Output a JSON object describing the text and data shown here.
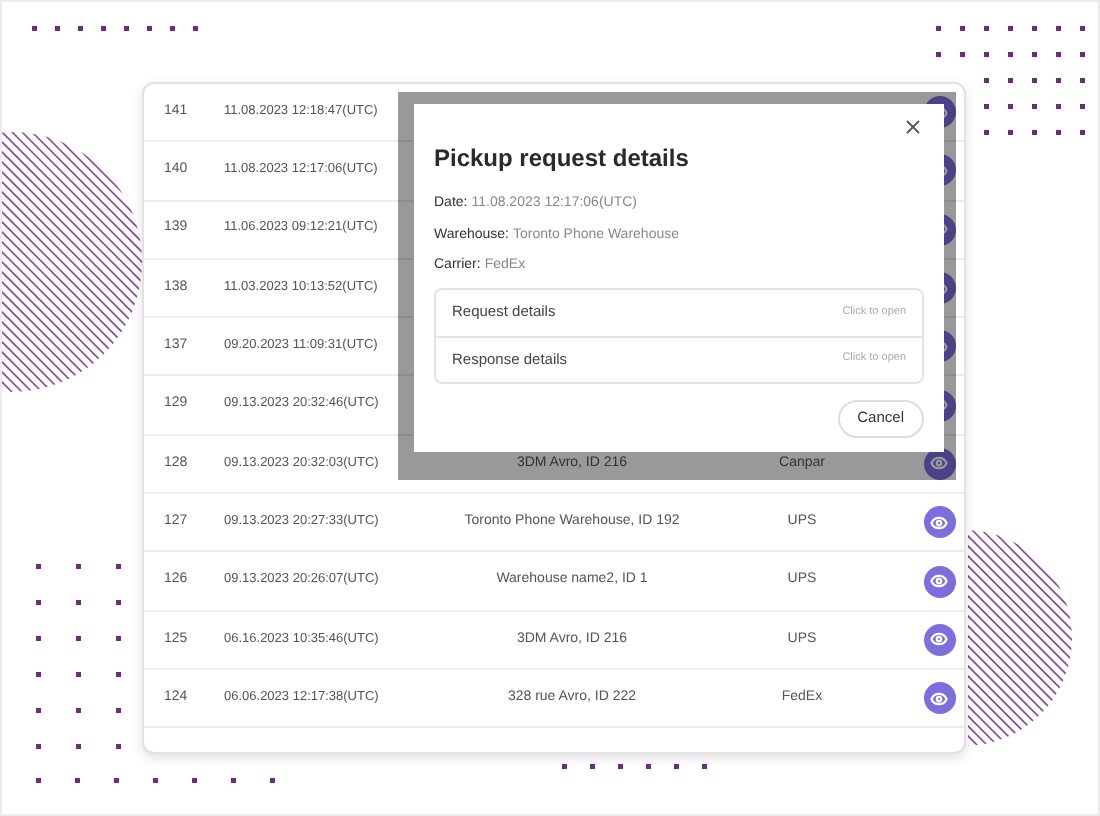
{
  "table": {
    "rows": [
      {
        "id": "141",
        "date": "11.08.2023 12:18:47(UTC)"
      },
      {
        "id": "140",
        "date": "11.08.2023 12:17:06(UTC)"
      },
      {
        "id": "139",
        "date": "11.06.2023 09:12:21(UTC)"
      },
      {
        "id": "138",
        "date": "11.03.2023 10:13:52(UTC)"
      },
      {
        "id": "137",
        "date": "09.20.2023 11:09:31(UTC)"
      },
      {
        "id": "129",
        "date": "09.13.2023 20:32:46(UTC)"
      },
      {
        "id": "128",
        "date": "09.13.2023 20:32:03(UTC)",
        "warehouse": "3DM Avro, ID 216",
        "carrier": "Canpar"
      },
      {
        "id": "127",
        "date": "09.13.2023 20:27:33(UTC)",
        "warehouse": "Toronto Phone Warehouse, ID 192",
        "carrier": "UPS"
      },
      {
        "id": "126",
        "date": "09.13.2023 20:26:07(UTC)",
        "warehouse": "Warehouse name2, ID 1",
        "carrier": "UPS"
      },
      {
        "id": "125",
        "date": "06.16.2023 10:35:46(UTC)",
        "warehouse": "3DM Avro, ID 216",
        "carrier": "UPS"
      },
      {
        "id": "124",
        "date": "06.06.2023 12:17:38(UTC)",
        "warehouse": "328 rue Avro, ID 222",
        "carrier": "FedEx"
      }
    ]
  },
  "modal": {
    "title": "Pickup request details",
    "fields": [
      {
        "label": "Date:",
        "value": "11.08.2023 12:17:06(UTC)"
      },
      {
        "label": "Warehouse:",
        "value": "Toronto Phone Warehouse"
      },
      {
        "label": "Carrier:",
        "value": "FedEx"
      }
    ],
    "sections": [
      {
        "title": "Request details",
        "hint": "Click to open"
      },
      {
        "title": "Response details",
        "hint": "Click to open"
      }
    ],
    "cancel": "Cancel"
  }
}
